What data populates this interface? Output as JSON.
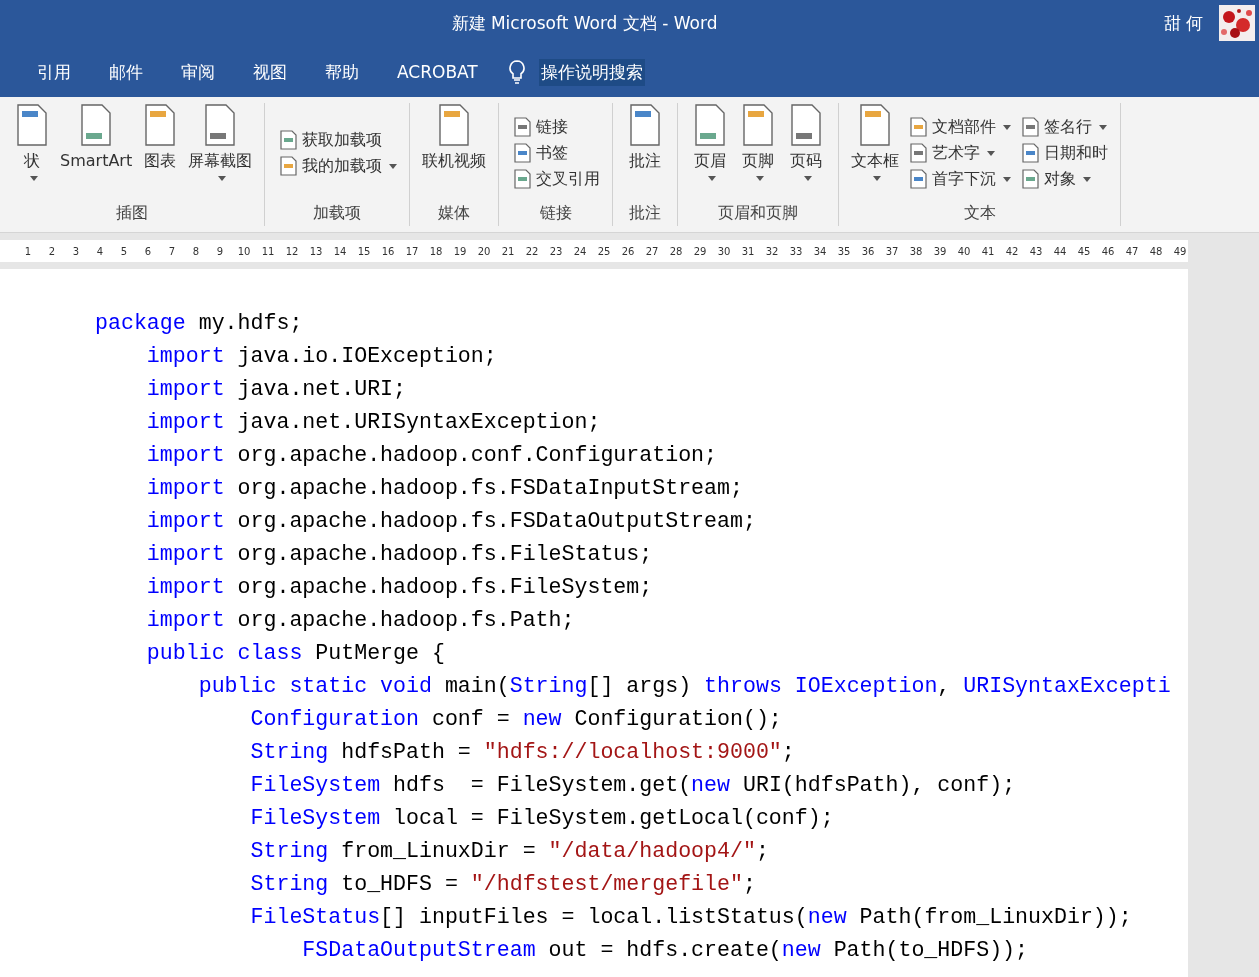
{
  "window": {
    "title": "新建 Microsoft Word 文档  -  Word",
    "user": "甜 何"
  },
  "tabs": [
    {
      "label": "引用",
      "selected": false
    },
    {
      "label": "邮件",
      "selected": false
    },
    {
      "label": "审阅",
      "selected": false
    },
    {
      "label": "视图",
      "selected": false
    },
    {
      "label": "帮助",
      "selected": false
    },
    {
      "label": "ACROBAT",
      "selected": false
    }
  ],
  "tell_me": {
    "label": "操作说明搜索"
  },
  "ribbon": [
    {
      "label": "插图",
      "items": [
        {
          "kind": "large",
          "label": "状",
          "dropdown": true
        },
        {
          "kind": "large",
          "label": "SmartArt",
          "dropdown": false
        },
        {
          "kind": "large",
          "label": "图表",
          "dropdown": false
        },
        {
          "kind": "large",
          "label": "屏幕截图",
          "dropdown": true
        }
      ]
    },
    {
      "label": "加载项",
      "items": [
        {
          "kind": "small",
          "label": "获取加载项",
          "dropdown": false
        },
        {
          "kind": "small",
          "label": "我的加载项",
          "dropdown": true
        }
      ]
    },
    {
      "label": "媒体",
      "items": [
        {
          "kind": "large",
          "label": "联机视频",
          "dropdown": false
        }
      ]
    },
    {
      "label": "链接",
      "items": [
        {
          "kind": "small",
          "label": "链接",
          "dropdown": false
        },
        {
          "kind": "small",
          "label": "书签",
          "dropdown": false
        },
        {
          "kind": "small",
          "label": "交叉引用",
          "dropdown": false
        }
      ]
    },
    {
      "label": "批注",
      "items": [
        {
          "kind": "large",
          "label": "批注",
          "dropdown": false
        }
      ]
    },
    {
      "label": "页眉和页脚",
      "items": [
        {
          "kind": "large",
          "label": "页眉",
          "dropdown": true
        },
        {
          "kind": "large",
          "label": "页脚",
          "dropdown": true
        },
        {
          "kind": "large",
          "label": "页码",
          "dropdown": true
        }
      ]
    },
    {
      "label": "文本",
      "items": [
        {
          "kind": "large",
          "label": "文本框",
          "dropdown": true
        },
        {
          "kind": "small",
          "label": "文档部件",
          "dropdown": true
        },
        {
          "kind": "small",
          "label": "艺术字",
          "dropdown": true
        },
        {
          "kind": "small",
          "label": "首字下沉",
          "dropdown": true
        },
        {
          "kind": "small",
          "label": "签名行",
          "dropdown": true
        },
        {
          "kind": "small",
          "label": "日期和时",
          "dropdown": false
        },
        {
          "kind": "small",
          "label": "对象",
          "dropdown": true
        }
      ]
    }
  ],
  "ruler": [
    "1",
    "2",
    "3",
    "4",
    "5",
    "6",
    "7",
    "8",
    "9",
    "10",
    "11",
    "12",
    "13",
    "14",
    "15",
    "16",
    "17",
    "18",
    "19",
    "20",
    "21",
    "22",
    "23",
    "24",
    "25",
    "26",
    "27",
    "28",
    "29",
    "30",
    "31",
    "32",
    "33",
    "34",
    "35",
    "36",
    "37",
    "38",
    "39",
    "40",
    "41",
    "42",
    "43",
    "44",
    "45",
    "46",
    "47",
    "48",
    "49"
  ],
  "code": [
    [
      {
        "kind": "kw",
        "text": "package"
      },
      {
        "kind": "plain",
        "text": " my.hdfs;"
      }
    ],
    [
      {
        "kind": "kw",
        "text": "    import"
      },
      {
        "kind": "plain",
        "text": " java.io.IOException;"
      }
    ],
    [
      {
        "kind": "kw",
        "text": "    import"
      },
      {
        "kind": "plain",
        "text": " java.net.URI;"
      }
    ],
    [
      {
        "kind": "kw",
        "text": "    import"
      },
      {
        "kind": "plain",
        "text": " java.net.URISyntaxException;"
      }
    ],
    [
      {
        "kind": "kw",
        "text": "    import"
      },
      {
        "kind": "plain",
        "text": " org.apache.hadoop.conf.Configuration;"
      }
    ],
    [
      {
        "kind": "kw",
        "text": "    import"
      },
      {
        "kind": "plain",
        "text": " org.apache.hadoop.fs.FSDataInputStream;"
      }
    ],
    [
      {
        "kind": "kw",
        "text": "    import"
      },
      {
        "kind": "plain",
        "text": " org.apache.hadoop.fs.FSDataOutputStream;"
      }
    ],
    [
      {
        "kind": "kw",
        "text": "    import"
      },
      {
        "kind": "plain",
        "text": " org.apache.hadoop.fs.FileStatus;"
      }
    ],
    [
      {
        "kind": "kw",
        "text": "    import"
      },
      {
        "kind": "plain",
        "text": " org.apache.hadoop.fs.FileSystem;"
      }
    ],
    [
      {
        "kind": "kw",
        "text": "    import"
      },
      {
        "kind": "plain",
        "text": " org.apache.hadoop.fs.Path;"
      }
    ],
    [
      {
        "kind": "kw",
        "text": "    public class"
      },
      {
        "kind": "plain",
        "text": " PutMerge {"
      }
    ],
    [
      {
        "kind": "kw",
        "text": "        public static void"
      },
      {
        "kind": "plain",
        "text": " main("
      },
      {
        "kind": "kw",
        "text": "String"
      },
      {
        "kind": "plain",
        "text": "[] args) "
      },
      {
        "kind": "kw",
        "text": "throws IOException"
      },
      {
        "kind": "plain",
        "text": ", "
      },
      {
        "kind": "kw",
        "text": "URISyntaxExcepti"
      }
    ],
    [
      {
        "kind": "kw",
        "text": "            Configuration"
      },
      {
        "kind": "plain",
        "text": " conf = "
      },
      {
        "kind": "kw",
        "text": "new"
      },
      {
        "kind": "plain",
        "text": " Configuration();"
      }
    ],
    [
      {
        "kind": "kw",
        "text": "            String"
      },
      {
        "kind": "plain",
        "text": " hdfsPath = "
      },
      {
        "kind": "str",
        "text": "\"hdfs://localhost:9000\""
      },
      {
        "kind": "plain",
        "text": ";"
      }
    ],
    [
      {
        "kind": "kw",
        "text": "            FileSystem"
      },
      {
        "kind": "plain",
        "text": " hdfs  = FileSystem.get("
      },
      {
        "kind": "kw",
        "text": "new"
      },
      {
        "kind": "plain",
        "text": " URI(hdfsPath), conf);"
      }
    ],
    [
      {
        "kind": "kw",
        "text": "            FileSystem"
      },
      {
        "kind": "plain",
        "text": " local = FileSystem.getLocal(conf);"
      }
    ],
    [
      {
        "kind": "kw",
        "text": "            String"
      },
      {
        "kind": "plain",
        "text": " from_LinuxDir = "
      },
      {
        "kind": "str",
        "text": "\"/data/hadoop4/\""
      },
      {
        "kind": "plain",
        "text": ";"
      }
    ],
    [
      {
        "kind": "kw",
        "text": "            String"
      },
      {
        "kind": "plain",
        "text": " to_HDFS = "
      },
      {
        "kind": "str",
        "text": "\"/hdfstest/mergefile\""
      },
      {
        "kind": "plain",
        "text": ";"
      }
    ],
    [
      {
        "kind": "kw",
        "text": "            FileStatus"
      },
      {
        "kind": "plain",
        "text": "[] inputFiles = local.listStatus("
      },
      {
        "kind": "kw",
        "text": "new"
      },
      {
        "kind": "plain",
        "text": " Path(from_LinuxDir));"
      }
    ],
    [
      {
        "kind": "kw",
        "text": "                FSDataOutputStream"
      },
      {
        "kind": "plain",
        "text": " out = hdfs.create("
      },
      {
        "kind": "kw",
        "text": "new"
      },
      {
        "kind": "plain",
        "text": " Path(to_HDFS));"
      }
    ]
  ]
}
